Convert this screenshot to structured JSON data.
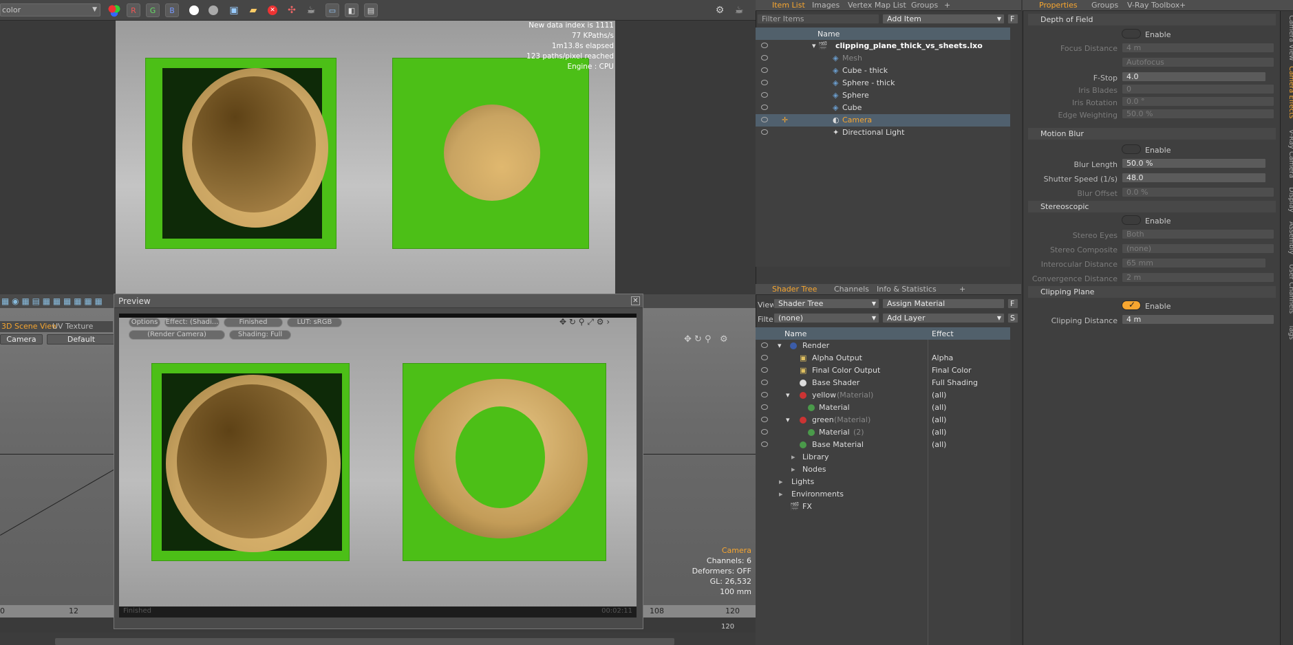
{
  "toolbar": {
    "color_dropdown": "color",
    "channel_r": "R",
    "channel_g": "G",
    "channel_b": "B"
  },
  "render_stats": {
    "line1": "New data index is 1111",
    "line2": "77 KPaths/s",
    "line3": "1m13.8s elapsed",
    "line4": "123 paths/pixel reached",
    "line5": "Engine : CPU"
  },
  "viewport": {
    "tabs": [
      "3D Scene View",
      "UV Texture View"
    ],
    "camera_btn": "Camera",
    "default_btn": "Default",
    "info_camera": "Camera",
    "info_channels": "Channels: 6",
    "info_deformers": "Deformers: OFF",
    "info_gl": "GL: 26,532",
    "info_size": "100 mm",
    "ruler": [
      "0",
      "12",
      "108",
      "120"
    ],
    "ruler_bottom": "120"
  },
  "preview": {
    "title": "Preview",
    "options": "Options",
    "effect": "Effect: (Shadi...",
    "status": "Finished",
    "lut": "LUT: sRGB",
    "camera": "(Render Camera)",
    "shading": "Shading: Full",
    "footer_left": "Finished",
    "footer_right": "00:02:11"
  },
  "item_list": {
    "tabs": [
      "Item List",
      "Images",
      "Vertex Map List",
      "Groups"
    ],
    "filter_placeholder": "Filter Items",
    "add_item": "Add Item",
    "f_button": "F",
    "header": "Name",
    "rows": [
      {
        "label": "clipping_plane_thick_vs_sheets.lxo"
      },
      {
        "label": "Mesh"
      },
      {
        "label": "Cube - thick"
      },
      {
        "label": "Sphere - thick"
      },
      {
        "label": "Sphere"
      },
      {
        "label": "Cube"
      },
      {
        "label": "Camera"
      },
      {
        "label": "Directional Light"
      }
    ]
  },
  "shader_tree": {
    "tabs": [
      "Shader Tree",
      "Channels",
      "Info & Statistics"
    ],
    "view_label": "View",
    "view_value": "Shader Tree",
    "assign_material": "Assign Material",
    "filter_label": "Filter",
    "filter_value": "(none)",
    "add_layer": "Add Layer",
    "f_button": "F",
    "s_button": "S",
    "col_name": "Name",
    "col_effect": "Effect",
    "rows": [
      {
        "name": "Render",
        "effect": ""
      },
      {
        "name": "Alpha Output",
        "effect": "Alpha"
      },
      {
        "name": "Final Color Output",
        "effect": "Final Color"
      },
      {
        "name": "Base Shader",
        "effect": "Full Shading"
      },
      {
        "name": "yellow",
        "suffix": "(Material)",
        "effect": "(all)"
      },
      {
        "name": "Material",
        "effect": "(all)"
      },
      {
        "name": "green",
        "suffix": "(Material)",
        "effect": "(all)"
      },
      {
        "name": "Material",
        "suffix": "(2)",
        "effect": "(all)"
      },
      {
        "name": "Base Material",
        "effect": "(all)"
      },
      {
        "name": "Library",
        "effect": ""
      },
      {
        "name": "Nodes",
        "effect": ""
      },
      {
        "name": "Lights",
        "effect": ""
      },
      {
        "name": "Environments",
        "effect": ""
      },
      {
        "name": "FX",
        "effect": ""
      }
    ]
  },
  "properties": {
    "tabs": [
      "Properties",
      "Groups",
      "V-Ray Toolbox"
    ],
    "dof_title": "Depth of Field",
    "enable": "Enable",
    "focus_distance_label": "Focus Distance",
    "focus_distance": "4 m",
    "autofocus": "Autofocus",
    "fstop_label": "F-Stop",
    "fstop": "4.0",
    "iris_blades_label": "Iris Blades",
    "iris_blades": "0",
    "iris_rotation_label": "Iris Rotation",
    "iris_rotation": "0.0 °",
    "edge_weighting_label": "Edge Weighting",
    "edge_weighting": "50.0 %",
    "motion_blur_title": "Motion Blur",
    "blur_length_label": "Blur Length",
    "blur_length": "50.0 %",
    "shutter_speed_label": "Shutter Speed (1/s)",
    "shutter_speed": "48.0",
    "blur_offset_label": "Blur Offset",
    "blur_offset": "0.0 %",
    "stereo_title": "Stereoscopic",
    "stereo_eyes_label": "Stereo Eyes",
    "stereo_eyes": "Both",
    "stereo_composite_label": "Stereo Composite",
    "stereo_composite": "(none)",
    "interocular_label": "Interocular Distance",
    "interocular": "65 mm",
    "convergence_label": "Convergence Distance",
    "convergence": "2 m",
    "clipping_title": "Clipping Plane",
    "clipping_distance_label": "Clipping Distance",
    "clipping_distance": "4 m"
  },
  "side_tabs": [
    "Camera View",
    "Camera Effects",
    "V-Ray Camera",
    "Display",
    "Assembly",
    "User Channels",
    "Tags"
  ],
  "colors": {
    "accent": "#f7a630",
    "green": "#4cbf17",
    "tan": "#c9a462"
  }
}
